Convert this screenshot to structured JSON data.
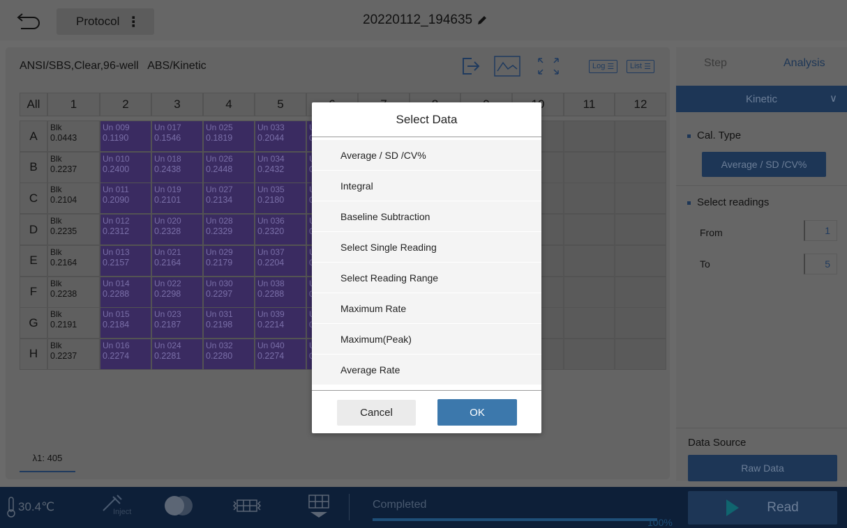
{
  "header": {
    "protocol_label": "Protocol",
    "file_title": "20220112_194635"
  },
  "panel": {
    "plate_info": "ANSI/SBS,Clear,96-well   ABS/Kinetic",
    "log_label": "Log",
    "list_label": "List",
    "wavelength_tab": "λ1: 405"
  },
  "plate": {
    "all_label": "All",
    "columns": [
      "1",
      "2",
      "3",
      "4",
      "5",
      "6",
      "7",
      "8",
      "9",
      "10",
      "11",
      "12"
    ],
    "rows": [
      "A",
      "B",
      "C",
      "D",
      "E",
      "F",
      "G",
      "H"
    ],
    "col1": [
      {
        "label": "Blk",
        "value": "0.0443"
      },
      {
        "label": "Blk",
        "value": "0.2237"
      },
      {
        "label": "Blk",
        "value": "0.2104"
      },
      {
        "label": "Blk",
        "value": "0.2235"
      },
      {
        "label": "Blk",
        "value": "0.2164"
      },
      {
        "label": "Blk",
        "value": "0.2238"
      },
      {
        "label": "Blk",
        "value": "0.2191"
      },
      {
        "label": "Blk",
        "value": "0.2237"
      }
    ],
    "col2": [
      {
        "label": "Un 009",
        "value": "0.1190"
      },
      {
        "label": "Un 010",
        "value": "0.2400"
      },
      {
        "label": "Un 011",
        "value": "0.2090"
      },
      {
        "label": "Un 012",
        "value": "0.2312"
      },
      {
        "label": "Un 013",
        "value": "0.2157"
      },
      {
        "label": "Un 014",
        "value": "0.2288"
      },
      {
        "label": "Un 015",
        "value": "0.2184"
      },
      {
        "label": "Un 016",
        "value": "0.2274"
      }
    ],
    "col3": [
      {
        "label": "Un 017",
        "value": "0.1546"
      },
      {
        "label": "Un 018",
        "value": "0.2438"
      },
      {
        "label": "Un 019",
        "value": "0.2101"
      },
      {
        "label": "Un 020",
        "value": "0.2328"
      },
      {
        "label": "Un 021",
        "value": "0.2164"
      },
      {
        "label": "Un 022",
        "value": "0.2298"
      },
      {
        "label": "Un 023",
        "value": "0.2187"
      },
      {
        "label": "Un 024",
        "value": "0.2281"
      }
    ],
    "col4": [
      {
        "label": "Un 025",
        "value": "0.1819"
      },
      {
        "label": "Un 026",
        "value": "0.2448"
      },
      {
        "label": "Un 027",
        "value": "0.2134"
      },
      {
        "label": "Un 028",
        "value": "0.2329"
      },
      {
        "label": "Un 029",
        "value": "0.2179"
      },
      {
        "label": "Un 030",
        "value": "0.2297"
      },
      {
        "label": "Un 031",
        "value": "0.2198"
      },
      {
        "label": "Un 032",
        "value": "0.2280"
      }
    ],
    "col5": [
      {
        "label": "Un 033",
        "value": "0.2044"
      },
      {
        "label": "Un 034",
        "value": "0.2432"
      },
      {
        "label": "Un 035",
        "value": "0.2180"
      },
      {
        "label": "Un 036",
        "value": "0.2320"
      },
      {
        "label": "Un 037",
        "value": "0.2204"
      },
      {
        "label": "Un 038",
        "value": "0.2288"
      },
      {
        "label": "Un 039",
        "value": "0.2214"
      },
      {
        "label": "Un 040",
        "value": "0.2274"
      }
    ],
    "col6_label": "U",
    "col6_value": "0"
  },
  "right_panel": {
    "tab_step": "Step",
    "tab_analysis": "Analysis",
    "mode": "Kinetic",
    "cal_type_title": "Cal. Type",
    "cal_type_value": "Average / SD /CV%",
    "select_readings_title": "Select readings",
    "from_label": "From",
    "from_value": "1",
    "to_label": "To",
    "to_value": "5",
    "data_source_title": "Data Source",
    "data_source_value": "Raw Data"
  },
  "bottom": {
    "temperature": "30.4℃",
    "inject_label": "Inject",
    "status": "Completed",
    "progress": 100,
    "progress_label": "100%",
    "read_label": "Read"
  },
  "modal": {
    "title": "Select Data",
    "options": [
      "Average / SD /CV%",
      "Integral",
      "Baseline Subtraction",
      "Select Single Reading",
      "Select Reading Range",
      "Maximum Rate",
      "Maximum(Peak)",
      "Average Rate"
    ],
    "cancel_label": "Cancel",
    "ok_label": "OK"
  },
  "colors": {
    "navy": "#1d3656",
    "purple_well": "#3a2b61",
    "ok_blue": "#3c78ac",
    "bottombar": "#0d1f38"
  }
}
